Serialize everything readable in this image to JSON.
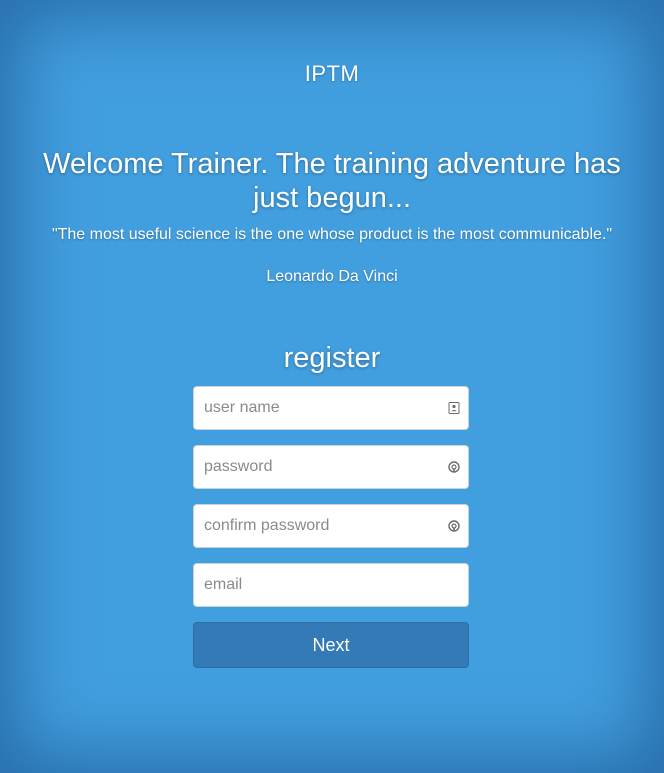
{
  "header": {
    "brand": "IPTM"
  },
  "hero": {
    "headline": "Welcome Trainer. The training adventure has just begun...",
    "quote": "\"The most useful science is the one whose product is the most communicable.\"",
    "author": "Leonardo Da Vinci"
  },
  "form": {
    "title": "register",
    "fields": [
      {
        "placeholder": "user name",
        "value": "",
        "icon": "contact-card-icon"
      },
      {
        "placeholder": "password",
        "value": "",
        "icon": "lifebuoy-icon"
      },
      {
        "placeholder": "confirm password",
        "value": "",
        "icon": "lifebuoy-icon"
      },
      {
        "placeholder": "email",
        "value": ""
      }
    ],
    "submit_label": "Next"
  },
  "colors": {
    "background": "#429fdf",
    "button": "#337ab7",
    "text": "#ffffff"
  }
}
